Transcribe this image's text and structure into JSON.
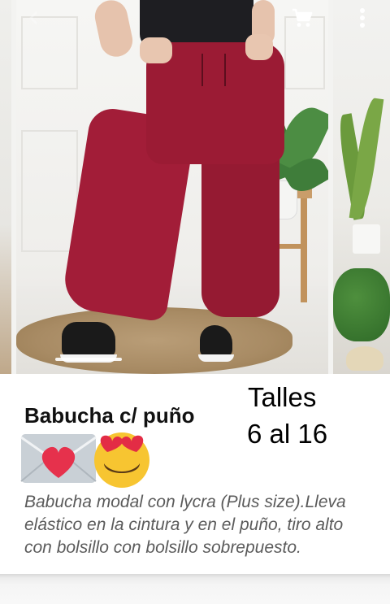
{
  "toolbar": {
    "back_icon": "chevron-left-icon",
    "cart_icon": "shopping-cart-icon",
    "more_icon": "more-vert-icon",
    "icon_color": "#ffffff"
  },
  "carousel": {
    "current_index": 2,
    "product_color": "#9b1b34"
  },
  "post": {
    "product_name": "Babucha c/ puño",
    "sizes_label": "Talles",
    "sizes_range": "6 al 16",
    "emojis": [
      "love-letter-emoji",
      "heart-eyes-emoji"
    ],
    "description": "Babucha modal con lycra (Plus size).Lleva elástico en la cintura y en el puño,  tiro alto con bolsillo con bolsillo sobrepuesto."
  }
}
